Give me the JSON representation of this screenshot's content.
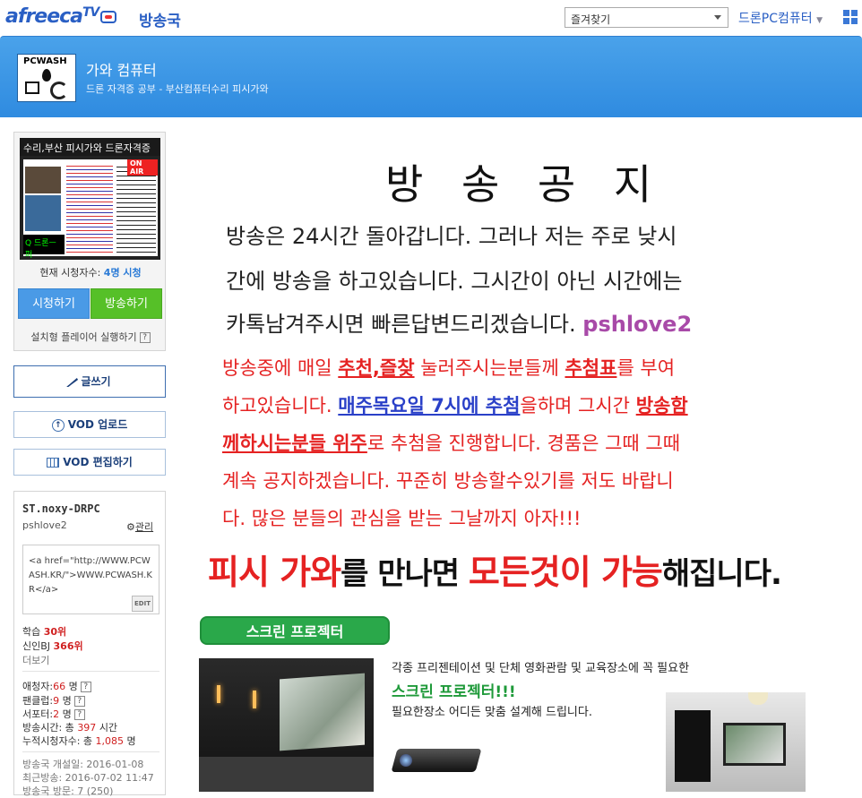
{
  "topbar": {
    "logo": "afreeca",
    "logo_tv": "TV",
    "section": "방송국",
    "favorites_label": "즐겨찾기",
    "user_menu": "드론PC컴퓨터"
  },
  "banner": {
    "logo_text": "PCWASH",
    "title": "가와 컴퓨터",
    "subtitle": "드론 자격증 공부 - 부산컴퓨터수리 피시가와"
  },
  "live": {
    "caption": "수리,부산 피시가와 드론자격증",
    "onair": "ON AIR",
    "thumb_text": "Q 드론ㅡ퍼",
    "viewers_prefix": "현재 시청자수:",
    "viewers_count": "4명 시청",
    "watch_btn": "시청하기",
    "broadcast_btn": "방송하기",
    "player_link": "설치형 플레이어 실행하기"
  },
  "side_buttons": {
    "write": "글쓰기",
    "vod_upload": "VOD 업로드",
    "vod_edit": "VOD 편집하기"
  },
  "profile": {
    "name": "ST.noxy-DRPC",
    "id": "pshlove2",
    "manage": "관리",
    "html_code": "<a href=\"http://WWW.PCWASH.KR/\">WWW.PCWASH.KR</a>",
    "edit_tag": "EDIT",
    "rank_learn_label": "학습",
    "rank_learn": "30위",
    "rank_new_label": "신인BJ",
    "rank_new": "366위",
    "more": "더보기",
    "fans_label": "애청자:",
    "fans": "66",
    "fanclub_label": "팬클럽:",
    "fanclub": "9",
    "supporters_label": "서포터:",
    "supporters": "2",
    "unit_people": "명",
    "airtime_label": "방송시간: 총",
    "airtime": "397",
    "airtime_unit": "시간",
    "total_viewers_label": "누적시청자수: 총",
    "total_viewers": "1,085",
    "opened": "방송국 개설일: 2016-01-08",
    "last_broadcast": "최근방송: 2016-07-02 11:47",
    "visits": "방송국 방문: 7 (250)"
  },
  "notice": {
    "title": "방 송 공 지",
    "line1": "방송은 24시간 돌아갑니다. 그러나 저는 주로 낮시",
    "line2": "간에 방송을 하고있습니다. 그시간이 아닌 시간에는",
    "line3": "카톡남겨주시면 빠른답변드리겠습니다.",
    "line3_id": "pshlove2",
    "r1a": "방송중에 매일 ",
    "r1b": "추천,즐찾",
    "r1c": " 눌러주시는분들께 ",
    "r1d": "추첨표",
    "r1e": "를 부여",
    "r2a": "하고있습니다. ",
    "r2b": "매주목요일 7시에 추첨",
    "r2c": "을하며 그시간 ",
    "r2d": "방송함",
    "r3a": "께하시는분들 위주",
    "r3b": "로 추첨을 진행합니다. 경품은 그때 그때",
    "r4": "계속 공지하겠습니다. 꾸준히 방송할수있기를 저도 바랍니",
    "r5": "다. 많은 분들의 관심을 받는 그날까지 아자!!!",
    "big_a": "피시 가와",
    "big_b": "를 만나면 ",
    "big_c": "모든것이 가능",
    "big_d": "해집니다."
  },
  "promo": {
    "pill": "스크린 프로젝터",
    "line1": "각종 프리젠테이션 및 단체 영화관람 및 교육장소에 꼭 필요한",
    "line2": "스크린 프로젝터!!!",
    "line3": "필요한장소 어디든 맞춤 설계해 드립니다."
  }
}
